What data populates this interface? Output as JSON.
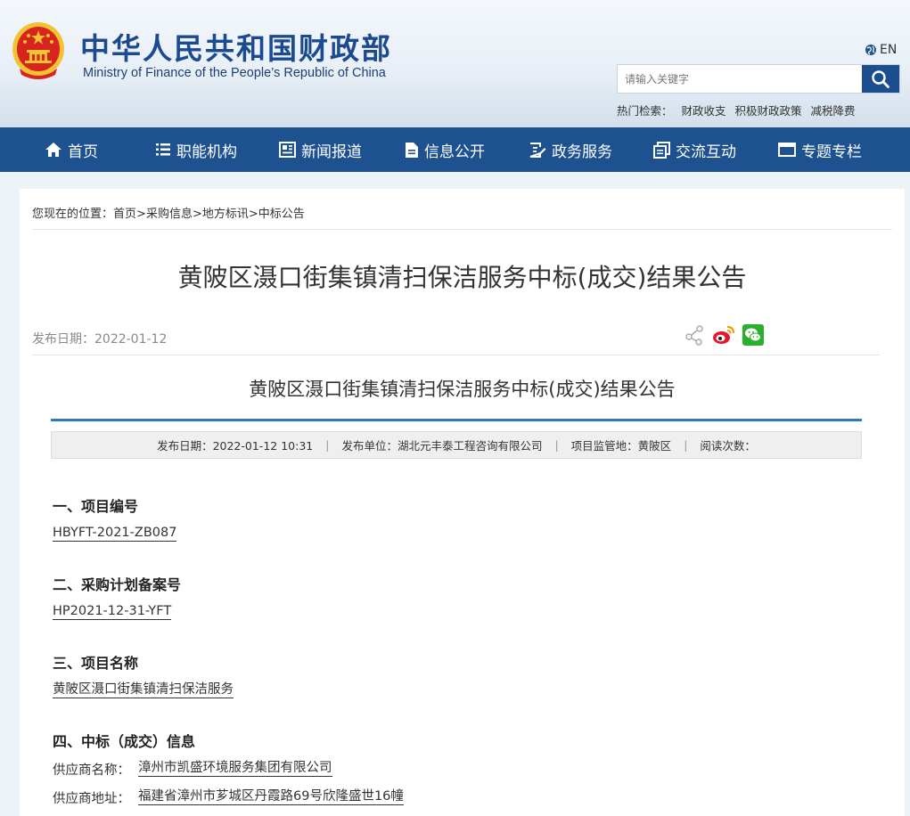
{
  "header": {
    "title_cn": "中华人民共和国财政部",
    "title_en": "Ministry of Finance of the People’s Republic of China",
    "lang_label": "EN",
    "search_placeholder": "请输入关键字",
    "hot_search_label": "热门检索：",
    "hot_items": [
      "财政收支",
      "积极财政政策",
      "减税降费"
    ]
  },
  "nav": {
    "items": [
      {
        "label": "首页",
        "icon": "home-icon"
      },
      {
        "label": "职能机构",
        "icon": "list-icon"
      },
      {
        "label": "新闻报道",
        "icon": "newspaper-icon"
      },
      {
        "label": "信息公开",
        "icon": "document-icon"
      },
      {
        "label": "政务服务",
        "icon": "form-edit-icon"
      },
      {
        "label": "交流互动",
        "icon": "copy-icon"
      },
      {
        "label": "专题专栏",
        "icon": "window-icon"
      }
    ]
  },
  "breadcrumb": {
    "prefix": "您现在的位置：",
    "items": [
      "首页",
      "采购信息",
      "地方标讯",
      "中标公告"
    ],
    "separator": ">"
  },
  "article": {
    "page_title": "黄陂区滠口街集镇清扫保洁服务中标(成交)结果公告",
    "publish_date_label": "发布日期：",
    "publish_date": "2022-01-12",
    "share_icons": [
      "share-icon",
      "weibo-icon",
      "wechat-icon"
    ],
    "inner_title": "黄陂区滠口街集镇清扫保洁服务中标(成交)结果公告",
    "meta": {
      "date": "发布日期：2022-01-12 10:31",
      "unit": "发布单位：湖北元丰泰工程咨询有限公司",
      "region": "项目监管地：黄陂区",
      "views": "阅读次数：",
      "separator": "|"
    },
    "sections": [
      {
        "heading": "一、项目编号",
        "value": "HBYFT-2021-ZB087"
      },
      {
        "heading": "二、采购计划备案号",
        "value": "HP2021-12-31-YFT"
      },
      {
        "heading": "三、项目名称",
        "value": "黄陂区滠口街集镇清扫保洁服务"
      },
      {
        "heading": "四、中标（成交）信息"
      }
    ],
    "supplier": {
      "name_label": "供应商名称：",
      "name": "漳州市凯盛环境服务集团有限公司",
      "address_label": "供应商地址：",
      "address": "福建省漳州市芗城区丹霞路69号欣隆盛世16幢"
    }
  },
  "colors": {
    "nav_bg": "#1d5190",
    "title_blue": "#1c4a8f",
    "rule_blue": "#2f78c2",
    "emblem_red": "#d7241f",
    "emblem_gold": "#f2c230"
  }
}
